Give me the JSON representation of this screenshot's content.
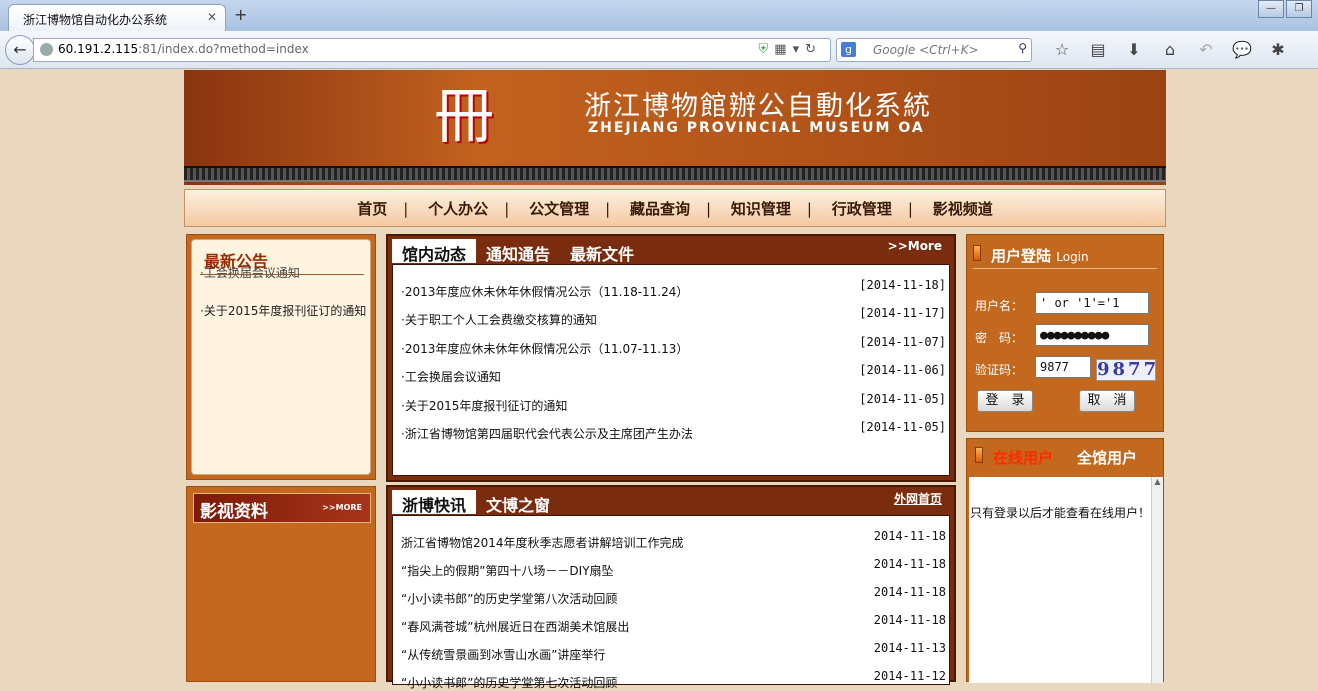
{
  "browser": {
    "tab_title": "浙江博物馆自动化办公系统",
    "new_tab": "+",
    "url_host": "60.191.2.115",
    "url_rest": ":81/index.do?method=index",
    "search_placeholder": "Google <Ctrl+K>",
    "search_engine_letter": "g",
    "toolbar_icons": [
      "star-icon",
      "reading-list-icon",
      "download-icon",
      "home-icon",
      "undo-icon",
      "chat-icon",
      "addon-icon"
    ]
  },
  "banner": {
    "title_cn": "浙江博物館辦公自動化系統",
    "title_en": "ZHEJIANG PROVINCIAL MUSEUM OA"
  },
  "nav": {
    "items": [
      "首页",
      "个人办公",
      "公文管理",
      "藏品查询",
      "知识管理",
      "行政管理",
      "影视频道"
    ],
    "separator": "|"
  },
  "notice": {
    "title": "最新公告",
    "items": [
      "·工会换届会议通知",
      "·关于2015年度报刊征订的通知"
    ]
  },
  "video": {
    "title": "影视资料",
    "more": ">>MORE"
  },
  "news_internal": {
    "tabs": [
      "馆内动态",
      "通知通告",
      "最新文件"
    ],
    "more": ">>More",
    "rows": [
      {
        "title": "·2013年度应休未休年休假情况公示（11.18-11.24）",
        "date": "[2014-11-18]"
      },
      {
        "title": "·关于职工个人工会费缴交核算的通知",
        "date": "[2014-11-17]"
      },
      {
        "title": "·2013年度应休未休年休假情况公示（11.07-11.13）",
        "date": "[2014-11-07]"
      },
      {
        "title": "·工会换届会议通知",
        "date": "[2014-11-06]"
      },
      {
        "title": "·关于2015年度报刊征订的通知",
        "date": "[2014-11-05]"
      },
      {
        "title": "·浙江省博物馆第四届职代会代表公示及主席团产生办法",
        "date": "[2014-11-05]"
      }
    ]
  },
  "news_external": {
    "tabs": [
      "浙博快讯",
      "文博之窗"
    ],
    "more": "外网首页",
    "rows": [
      {
        "title": "浙江省博物馆2014年度秋季志愿者讲解培训工作完成",
        "date": "2014-11-18"
      },
      {
        "title": "“指尖上的假期”第四十八场－－DIY扇坠",
        "date": "2014-11-18"
      },
      {
        "title": "“小小读书郎”的历史学堂第八次活动回顾",
        "date": "2014-11-18"
      },
      {
        "title": "“春风满苍城”杭州展近日在西湖美术馆展出",
        "date": "2014-11-18"
      },
      {
        "title": "“从传统雪景画到冰雪山水画”讲座举行",
        "date": "2014-11-13"
      },
      {
        "title": "“小小读书郎”的历史学堂第七次活动回顾",
        "date": "2014-11-12"
      }
    ]
  },
  "login": {
    "title": "用户登陆",
    "title_en": "Login",
    "username_label": "用户名：",
    "username_value": "' or '1'='1",
    "password_label": "密　码：",
    "password_value": "●●●●●●●●●●",
    "captcha_label": "验证码：",
    "captcha_value": "9877",
    "captcha_image_text": "9877",
    "login_button": "登　录",
    "cancel_button": "取　消"
  },
  "online": {
    "tab_online": "在线用户",
    "tab_all": "全馆用户",
    "message": "只有登录以后才能查看在线用户！",
    "online_color": "#ff2a00"
  }
}
